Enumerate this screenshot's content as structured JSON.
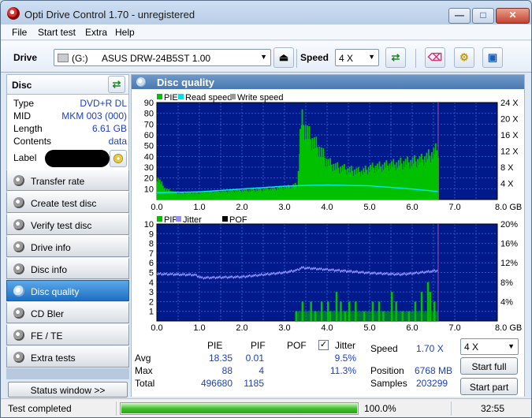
{
  "window": {
    "title": "Opti Drive Control 1.70 - unregistered",
    "min_glyph": "—",
    "max_glyph": "□",
    "close_glyph": "✕"
  },
  "menu": [
    "File",
    "Start test",
    "Extra",
    "Help"
  ],
  "toolbar": {
    "drive_label": "Drive",
    "drive_letter": "(G:)",
    "drive_model": "ASUS DRW-24B5ST 1.00",
    "speed_label": "Speed",
    "speed_value": "4 X"
  },
  "disc": {
    "header": "Disc",
    "rows": [
      {
        "key": "Type",
        "value": "DVD+R DL"
      },
      {
        "key": "MID",
        "value": "MKM 003 (000)"
      },
      {
        "key": "Length",
        "value": "6.61 GB"
      },
      {
        "key": "Contents",
        "value": "data"
      },
      {
        "key": "Label",
        "value": ""
      }
    ]
  },
  "nav": [
    "Transfer rate",
    "Create test disc",
    "Verify test disc",
    "Drive info",
    "Disc info",
    "Disc quality",
    "CD Bler",
    "FE / TE",
    "Extra tests"
  ],
  "nav_active": "Disc quality",
  "status_window_button": "Status window >>",
  "panel_title": "Disc quality",
  "chart_data": [
    {
      "type": "area",
      "legend": [
        "PIE",
        "Read speed",
        "Write speed"
      ],
      "legend_colors": [
        "#00c000",
        "#00e0e0",
        "#9a9a9a"
      ],
      "x_ticks": [
        "0.0",
        "1.0",
        "2.0",
        "3.0",
        "4.0",
        "5.0",
        "6.0",
        "7.0",
        "8.0 GB"
      ],
      "y_left_ticks": [
        "90",
        "80",
        "70",
        "60",
        "50",
        "40",
        "30",
        "20",
        "10"
      ],
      "y_right_ticks": [
        "24 X",
        "20 X",
        "16 X",
        "12 X",
        "8 X",
        "4 X"
      ],
      "xlim": [
        0,
        8
      ],
      "ylim": [
        0,
        90
      ],
      "y2lim": [
        0,
        24
      ],
      "series": [
        {
          "name": "PIE",
          "x": [
            0,
            0.2,
            0.5,
            1.0,
            1.5,
            2.0,
            2.5,
            3.0,
            3.3,
            3.38,
            3.45,
            3.6,
            3.8,
            4.0,
            4.2,
            4.5,
            4.8,
            5.0,
            5.3,
            5.6,
            5.9,
            6.2,
            6.45,
            6.61
          ],
          "values": [
            22,
            10,
            6,
            7,
            8,
            9,
            10,
            12,
            15,
            82,
            75,
            62,
            52,
            38,
            33,
            30,
            28,
            32,
            34,
            36,
            38,
            40,
            46,
            52
          ]
        },
        {
          "name": "Read speed",
          "x": [
            0,
            1.0,
            2.0,
            3.0,
            3.5,
            4.0,
            5.0,
            6.0,
            6.61
          ],
          "values": [
            1.7,
            1.9,
            2.6,
            3.3,
            3.5,
            3.6,
            3.4,
            2.6,
            2.0
          ]
        }
      ]
    },
    {
      "type": "bar",
      "legend": [
        "PIF",
        "Jitter",
        "POF"
      ],
      "legend_colors": [
        "#00c000",
        "#9090ff",
        "#000000"
      ],
      "x_ticks": [
        "0.0",
        "1.0",
        "2.0",
        "3.0",
        "4.0",
        "5.0",
        "6.0",
        "7.0",
        "8.0 GB"
      ],
      "y_left_ticks": [
        "10",
        "9",
        "8",
        "7",
        "6",
        "5",
        "4",
        "3",
        "2",
        "1"
      ],
      "y_right_ticks": [
        "20%",
        "16%",
        "12%",
        "8%",
        "4%"
      ],
      "xlim": [
        0,
        8
      ],
      "ylim": [
        0,
        10
      ],
      "y2lim": [
        0,
        20
      ],
      "series": [
        {
          "name": "PIF",
          "x": [
            3.25,
            3.4,
            3.6,
            3.7,
            3.85,
            4.0,
            4.05,
            4.2,
            4.3,
            4.4,
            4.5,
            4.65,
            4.85,
            5.05,
            5.2,
            5.3,
            5.5,
            5.6,
            5.75,
            5.9,
            6.05,
            6.2,
            6.35,
            6.4,
            6.5
          ],
          "values": [
            1,
            2,
            2,
            1,
            2,
            2,
            1,
            3,
            2,
            1,
            2,
            2,
            1,
            2,
            2,
            1,
            3,
            2,
            1,
            1,
            2,
            3,
            4,
            3,
            2
          ]
        },
        {
          "name": "Jitter",
          "x": [
            0,
            0.9,
            1.05,
            2.0,
            3.0,
            3.3,
            3.4,
            4.0,
            5.0,
            5.7,
            6.0,
            6.61
          ],
          "values": [
            9.7,
            9.5,
            8.9,
            9.1,
            10.0,
            10.5,
            11.0,
            10.6,
            9.9,
            9.6,
            9.8,
            10.4
          ]
        }
      ]
    }
  ],
  "stats": {
    "col_headers": [
      "PIE",
      "PIF",
      "POF",
      "Jitter"
    ],
    "jitter_checked": "✓",
    "rows": [
      {
        "label": "Avg",
        "pie": "18.35",
        "pif": "0.01",
        "pof": "",
        "jitter": "9.5%"
      },
      {
        "label": "Max",
        "pie": "88",
        "pif": "4",
        "pof": "",
        "jitter": "11.3%"
      },
      {
        "label": "Total",
        "pie": "496680",
        "pif": "1185",
        "pof": "",
        "jitter": ""
      }
    ],
    "speed_label": "Speed",
    "speed_value": "1.70 X",
    "position_label": "Position",
    "position_value": "6768 MB",
    "samples_label": "Samples",
    "samples_value": "203299",
    "speed_select": "4 X",
    "start_full": "Start full",
    "start_part": "Start part"
  },
  "statusbar": {
    "text": "Test completed",
    "progress": 1.0,
    "progress_label": "100.0%",
    "time": "32:55"
  }
}
